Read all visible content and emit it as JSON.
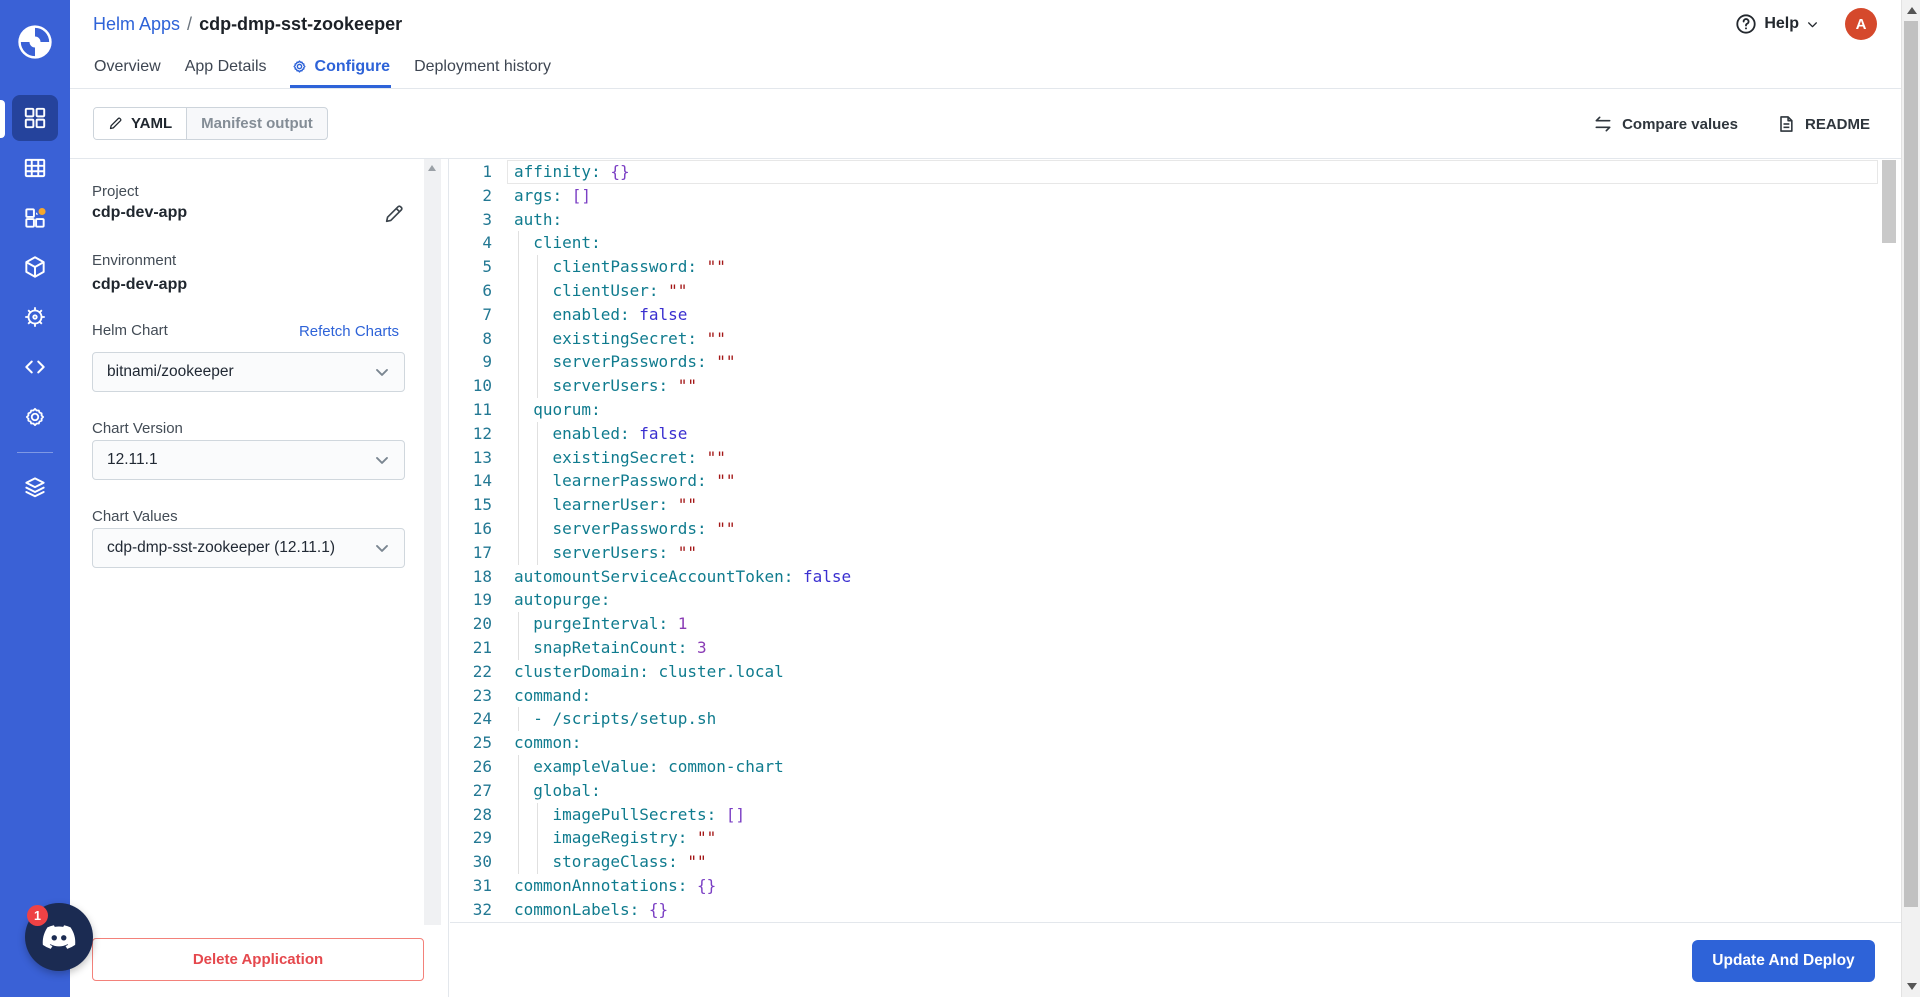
{
  "header": {
    "breadcrumb_section": "Helm Apps",
    "breadcrumb_separator": "/",
    "breadcrumb_app": "cdp-dmp-sst-zookeeper",
    "help_label": "Help",
    "avatar_initial": "A"
  },
  "tabs": [
    {
      "label": "Overview",
      "active": false
    },
    {
      "label": "App Details",
      "active": false
    },
    {
      "label": "Configure",
      "active": true,
      "icon": "gear-icon"
    },
    {
      "label": "Deployment history",
      "active": false
    }
  ],
  "toolbar": {
    "modes": [
      {
        "label": "YAML",
        "active": true,
        "icon": "pencil-icon"
      },
      {
        "label": "Manifest output",
        "active": false
      }
    ],
    "compare_label": "Compare values",
    "readme_label": "README"
  },
  "sidebar": {
    "items": [
      {
        "icon": "apps-grid-icon",
        "active": true
      },
      {
        "icon": "table-grid-icon",
        "active": false
      },
      {
        "icon": "widgets-icon",
        "active": false,
        "badge": true
      },
      {
        "icon": "cube-icon",
        "active": false
      },
      {
        "icon": "helm-wheel-icon",
        "active": false
      },
      {
        "icon": "code-icon",
        "active": false
      },
      {
        "icon": "gear-icon",
        "active": false
      },
      {
        "icon": "layers-icon",
        "active": false
      }
    ]
  },
  "panel": {
    "project_label": "Project",
    "project_value": "cdp-dev-app",
    "environment_label": "Environment",
    "environment_value": "cdp-dev-app",
    "helm_chart_label": "Helm Chart",
    "refetch_link": "Refetch Charts",
    "helm_chart_value": "bitnami/zookeeper",
    "chart_version_label": "Chart Version",
    "chart_version_value": "12.11.1",
    "chart_values_label": "Chart Values",
    "chart_values_value": "cdp-dmp-sst-zookeeper (12.11.1)",
    "delete_button": "Delete Application"
  },
  "footer": {
    "deploy_button": "Update And Deploy"
  },
  "discord": {
    "badge": "1"
  },
  "editor": {
    "language": "yaml",
    "current_line": 1,
    "lines": [
      {
        "ind": 0,
        "tokens": [
          [
            "k",
            "affinity"
          ],
          [
            "p",
            ": "
          ],
          [
            "c",
            "{}"
          ]
        ]
      },
      {
        "ind": 0,
        "tokens": [
          [
            "k",
            "args"
          ],
          [
            "p",
            ": "
          ],
          [
            "c",
            "[]"
          ]
        ]
      },
      {
        "ind": 0,
        "tokens": [
          [
            "k",
            "auth"
          ],
          [
            "p",
            ":"
          ]
        ]
      },
      {
        "ind": 1,
        "tokens": [
          [
            "k",
            "client"
          ],
          [
            "p",
            ":"
          ]
        ]
      },
      {
        "ind": 2,
        "tokens": [
          [
            "k",
            "clientPassword"
          ],
          [
            "p",
            ": "
          ],
          [
            "q",
            "\"\""
          ]
        ]
      },
      {
        "ind": 2,
        "tokens": [
          [
            "k",
            "clientUser"
          ],
          [
            "p",
            ": "
          ],
          [
            "q",
            "\"\""
          ]
        ]
      },
      {
        "ind": 2,
        "tokens": [
          [
            "k",
            "enabled"
          ],
          [
            "p",
            ": "
          ],
          [
            "b",
            "false"
          ]
        ]
      },
      {
        "ind": 2,
        "tokens": [
          [
            "k",
            "existingSecret"
          ],
          [
            "p",
            ": "
          ],
          [
            "q",
            "\"\""
          ]
        ]
      },
      {
        "ind": 2,
        "tokens": [
          [
            "k",
            "serverPasswords"
          ],
          [
            "p",
            ": "
          ],
          [
            "q",
            "\"\""
          ]
        ]
      },
      {
        "ind": 2,
        "tokens": [
          [
            "k",
            "serverUsers"
          ],
          [
            "p",
            ": "
          ],
          [
            "q",
            "\"\""
          ]
        ]
      },
      {
        "ind": 1,
        "tokens": [
          [
            "k",
            "quorum"
          ],
          [
            "p",
            ":"
          ]
        ]
      },
      {
        "ind": 2,
        "tokens": [
          [
            "k",
            "enabled"
          ],
          [
            "p",
            ": "
          ],
          [
            "b",
            "false"
          ]
        ]
      },
      {
        "ind": 2,
        "tokens": [
          [
            "k",
            "existingSecret"
          ],
          [
            "p",
            ": "
          ],
          [
            "q",
            "\"\""
          ]
        ]
      },
      {
        "ind": 2,
        "tokens": [
          [
            "k",
            "learnerPassword"
          ],
          [
            "p",
            ": "
          ],
          [
            "q",
            "\"\""
          ]
        ]
      },
      {
        "ind": 2,
        "tokens": [
          [
            "k",
            "learnerUser"
          ],
          [
            "p",
            ": "
          ],
          [
            "q",
            "\"\""
          ]
        ]
      },
      {
        "ind": 2,
        "tokens": [
          [
            "k",
            "serverPasswords"
          ],
          [
            "p",
            ": "
          ],
          [
            "q",
            "\"\""
          ]
        ]
      },
      {
        "ind": 2,
        "tokens": [
          [
            "k",
            "serverUsers"
          ],
          [
            "p",
            ": "
          ],
          [
            "q",
            "\"\""
          ]
        ]
      },
      {
        "ind": 0,
        "tokens": [
          [
            "k",
            "automountServiceAccountToken"
          ],
          [
            "p",
            ": "
          ],
          [
            "b",
            "false"
          ]
        ]
      },
      {
        "ind": 0,
        "tokens": [
          [
            "k",
            "autopurge"
          ],
          [
            "p",
            ":"
          ]
        ]
      },
      {
        "ind": 1,
        "tokens": [
          [
            "k",
            "purgeInterval"
          ],
          [
            "p",
            ": "
          ],
          [
            "n",
            "1"
          ]
        ]
      },
      {
        "ind": 1,
        "tokens": [
          [
            "k",
            "snapRetainCount"
          ],
          [
            "p",
            ": "
          ],
          [
            "n",
            "3"
          ]
        ]
      },
      {
        "ind": 0,
        "tokens": [
          [
            "k",
            "clusterDomain"
          ],
          [
            "p",
            ": "
          ],
          [
            "s",
            "cluster.local"
          ]
        ]
      },
      {
        "ind": 0,
        "tokens": [
          [
            "k",
            "command"
          ],
          [
            "p",
            ":"
          ]
        ]
      },
      {
        "ind": 1,
        "tokens": [
          [
            "p",
            "- "
          ],
          [
            "s",
            "/scripts/setup.sh"
          ]
        ]
      },
      {
        "ind": 0,
        "tokens": [
          [
            "k",
            "common"
          ],
          [
            "p",
            ":"
          ]
        ]
      },
      {
        "ind": 1,
        "tokens": [
          [
            "k",
            "exampleValue"
          ],
          [
            "p",
            ": "
          ],
          [
            "s",
            "common-chart"
          ]
        ]
      },
      {
        "ind": 1,
        "tokens": [
          [
            "k",
            "global"
          ],
          [
            "p",
            ":"
          ]
        ]
      },
      {
        "ind": 2,
        "tokens": [
          [
            "k",
            "imagePullSecrets"
          ],
          [
            "p",
            ": "
          ],
          [
            "c",
            "[]"
          ]
        ]
      },
      {
        "ind": 2,
        "tokens": [
          [
            "k",
            "imageRegistry"
          ],
          [
            "p",
            ": "
          ],
          [
            "q",
            "\"\""
          ]
        ]
      },
      {
        "ind": 2,
        "tokens": [
          [
            "k",
            "storageClass"
          ],
          [
            "p",
            ": "
          ],
          [
            "q",
            "\"\""
          ]
        ]
      },
      {
        "ind": 0,
        "tokens": [
          [
            "k",
            "commonAnnotations"
          ],
          [
            "p",
            ": "
          ],
          [
            "c",
            "{}"
          ]
        ]
      },
      {
        "ind": 0,
        "tokens": [
          [
            "k",
            "commonLabels"
          ],
          [
            "p",
            ": "
          ],
          [
            "c",
            "{}"
          ]
        ]
      }
    ]
  },
  "colors": {
    "accent": "#2e63d8",
    "sidebar": "#3a61d6",
    "sidebar-active": "#25439c",
    "avatar": "#d5492c",
    "delete-red": "#e5484d",
    "discord": "#1b2b52",
    "badge-red": "#ee4245",
    "code-key": "#0f7b8e",
    "code-quoted": "#a31515",
    "code-keyword": "#3a2fd0",
    "code-number": "#8a3cb5",
    "code-bracket": "#7b3fc4",
    "line-number": "#237893"
  }
}
